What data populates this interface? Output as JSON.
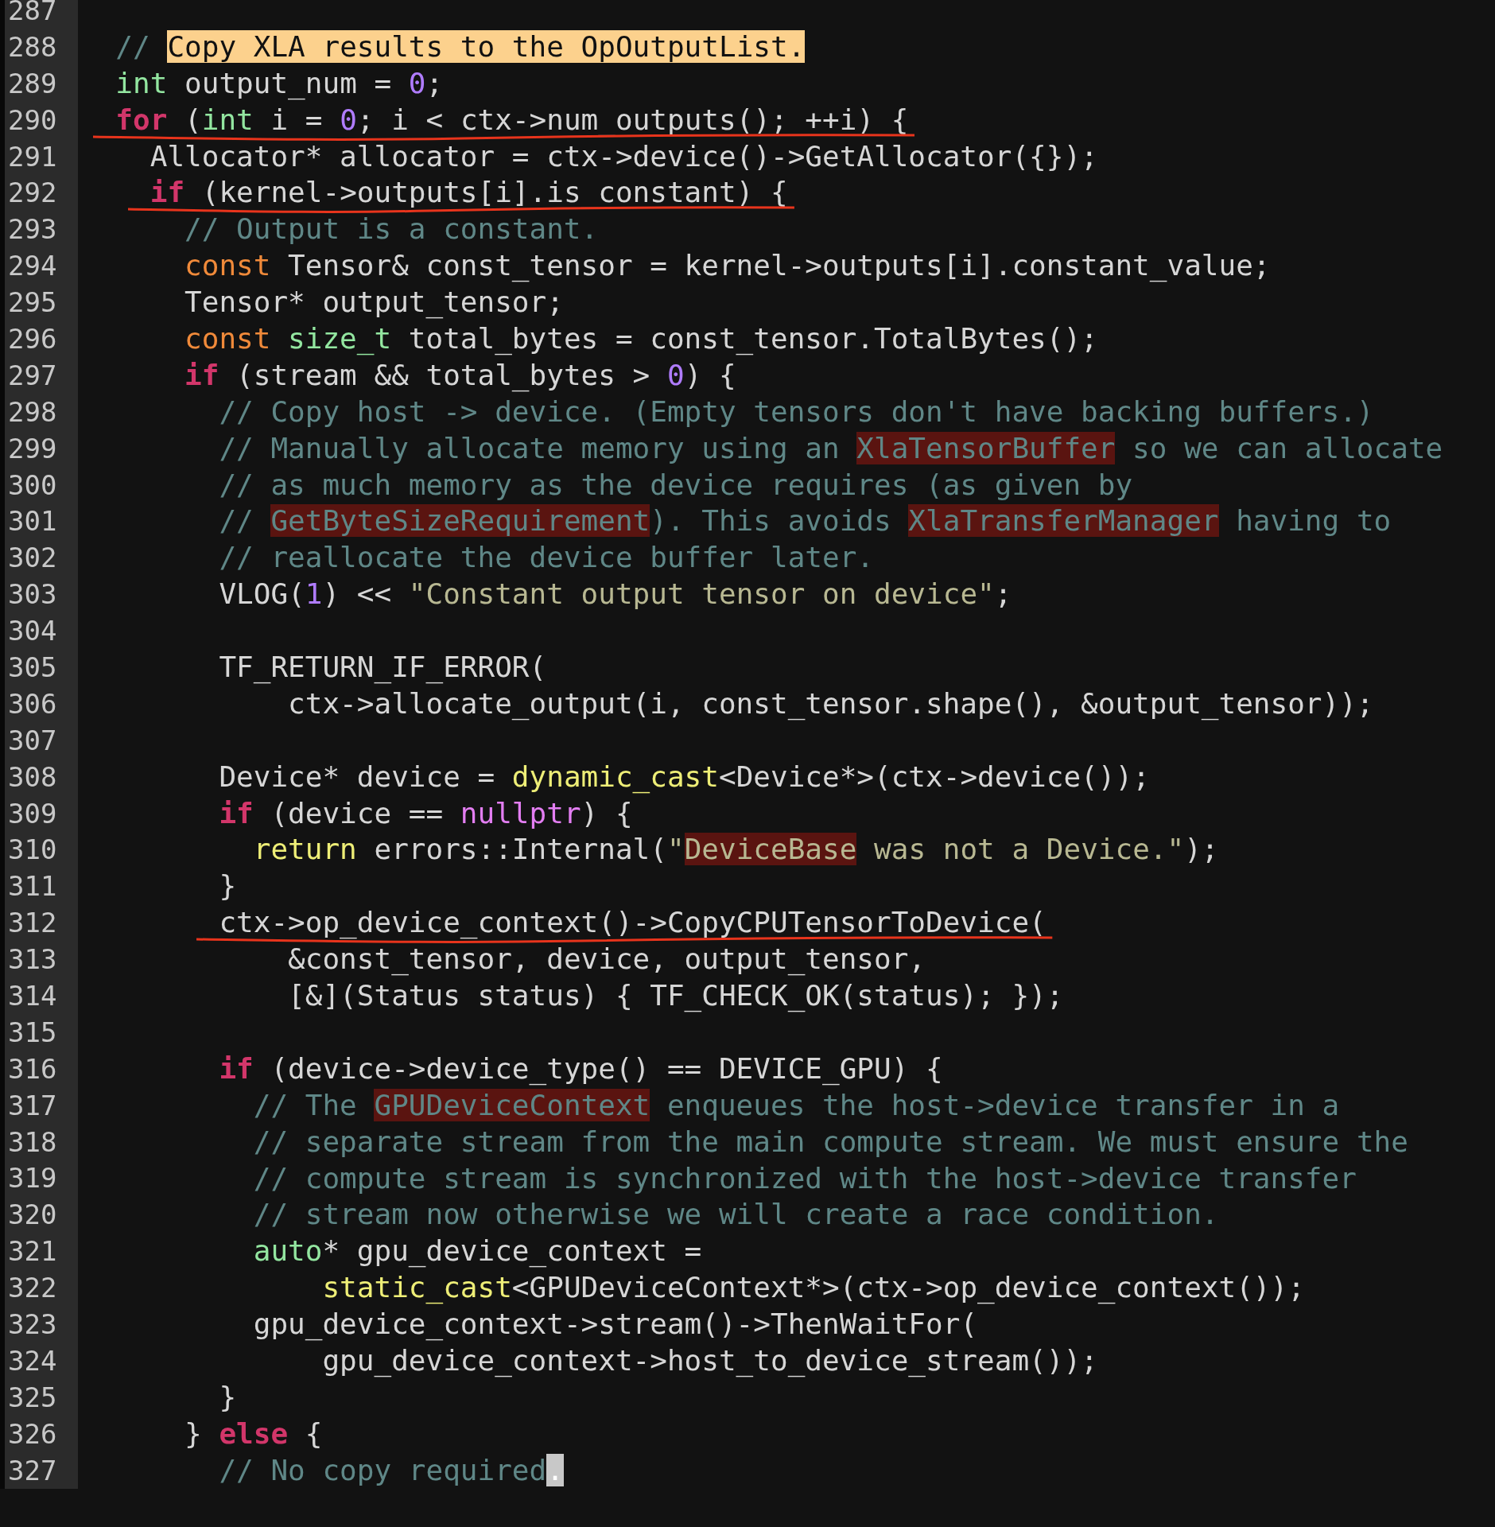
{
  "lines": [
    {
      "number": "287",
      "underlined": false
    },
    {
      "number": "288",
      "underlined": false,
      "tokens": [
        {
          "text": "  // ",
          "kind": "comment"
        },
        {
          "text": "Copy XLA results to the OpOutputList.",
          "kind": "search"
        }
      ]
    },
    {
      "number": "289",
      "underlined": false,
      "tokens": [
        {
          "text": "  int",
          "kind": "type"
        },
        {
          "text": " output_num = ",
          "kind": "plain"
        },
        {
          "text": "0",
          "kind": "number"
        },
        {
          "text": ";",
          "kind": "plain"
        }
      ]
    },
    {
      "number": "290",
      "underlined": true,
      "tokens": [
        {
          "text": "  for",
          "kind": "keyword"
        },
        {
          "text": " (",
          "kind": "plain"
        },
        {
          "text": "int",
          "kind": "type"
        },
        {
          "text": " i = ",
          "kind": "plain"
        },
        {
          "text": "0",
          "kind": "number"
        },
        {
          "text": "; i < ctx->num_outputs(); ++i) {",
          "kind": "plain"
        }
      ]
    },
    {
      "number": "291",
      "underlined": false,
      "tokens": [
        {
          "text": "    Allocator* allocator = ctx->device()->GetAllocator({});",
          "kind": "plain"
        }
      ]
    },
    {
      "number": "292",
      "underlined": true,
      "tokens": [
        {
          "text": "    if",
          "kind": "keyword"
        },
        {
          "text": " (kernel->outputs[i].is_constant) {",
          "kind": "plain"
        }
      ]
    },
    {
      "number": "293",
      "underlined": false,
      "tokens": [
        {
          "text": "      // Output is a constant.",
          "kind": "comment"
        }
      ]
    },
    {
      "number": "294",
      "underlined": false,
      "tokens": [
        {
          "text": "      const",
          "kind": "qualifier"
        },
        {
          "text": " Tensor& const_tensor = kernel->outputs[i].constant_value;",
          "kind": "plain"
        }
      ]
    },
    {
      "number": "295",
      "underlined": false,
      "tokens": [
        {
          "text": "      Tensor* output_tensor;",
          "kind": "plain"
        }
      ]
    },
    {
      "number": "296",
      "underlined": false,
      "tokens": [
        {
          "text": "      const ",
          "kind": "qualifier"
        },
        {
          "text": "size_t",
          "kind": "type"
        },
        {
          "text": " total_bytes = const_tensor.TotalBytes();",
          "kind": "plain"
        }
      ]
    },
    {
      "number": "297",
      "underlined": false,
      "tokens": [
        {
          "text": "      if",
          "kind": "keyword"
        },
        {
          "text": " (stream && total_bytes > ",
          "kind": "plain"
        },
        {
          "text": "0",
          "kind": "number"
        },
        {
          "text": ") {",
          "kind": "plain"
        }
      ]
    },
    {
      "number": "298",
      "underlined": false,
      "tokens": [
        {
          "text": "        // Copy host -> device. (Empty tensors don't have backing buffers.)",
          "kind": "comment"
        }
      ]
    },
    {
      "number": "299",
      "underlined": false,
      "tokens": [
        {
          "text": "        // Manually allocate memory using an ",
          "kind": "comment"
        },
        {
          "text": "XlaTensorBuffer",
          "kind": "flagcomment"
        },
        {
          "text": " so we can allocate",
          "kind": "comment"
        }
      ]
    },
    {
      "number": "300",
      "underlined": false,
      "tokens": [
        {
          "text": "        // as much memory as the device requires (as given by",
          "kind": "comment"
        }
      ]
    },
    {
      "number": "301",
      "underlined": false,
      "tokens": [
        {
          "text": "        // ",
          "kind": "comment"
        },
        {
          "text": "GetByteSizeRequirement",
          "kind": "flagcomment"
        },
        {
          "text": "). This avoids ",
          "kind": "comment"
        },
        {
          "text": "XlaTransferManager",
          "kind": "flagcomment"
        },
        {
          "text": " having to",
          "kind": "comment"
        }
      ]
    },
    {
      "number": "302",
      "underlined": false,
      "tokens": [
        {
          "text": "        // reallocate the device buffer later.",
          "kind": "comment"
        }
      ]
    },
    {
      "number": "303",
      "underlined": false,
      "tokens": [
        {
          "text": "        VLOG(",
          "kind": "plain"
        },
        {
          "text": "1",
          "kind": "number"
        },
        {
          "text": ") << ",
          "kind": "plain"
        },
        {
          "text": "\"Constant output tensor on device\"",
          "kind": "string"
        },
        {
          "text": ";",
          "kind": "plain"
        }
      ]
    },
    {
      "number": "304",
      "underlined": false
    },
    {
      "number": "305",
      "underlined": false,
      "tokens": [
        {
          "text": "        TF_RETURN_IF_ERROR(",
          "kind": "plain"
        }
      ]
    },
    {
      "number": "306",
      "underlined": false,
      "tokens": [
        {
          "text": "            ctx->allocate_output(i, const_tensor.shape(), &output_tensor));",
          "kind": "plain"
        }
      ]
    },
    {
      "number": "307",
      "underlined": false
    },
    {
      "number": "308",
      "underlined": false,
      "tokens": [
        {
          "text": "        Device* device = ",
          "kind": "plain"
        },
        {
          "text": "dynamic_cast",
          "kind": "builtin"
        },
        {
          "text": "<Device*>(ctx->device());",
          "kind": "plain"
        }
      ]
    },
    {
      "number": "309",
      "underlined": false,
      "tokens": [
        {
          "text": "        if",
          "kind": "keyword"
        },
        {
          "text": " (device == ",
          "kind": "plain"
        },
        {
          "text": "nullptr",
          "kind": "constant"
        },
        {
          "text": ") {",
          "kind": "plain"
        }
      ]
    },
    {
      "number": "310",
      "underlined": false,
      "tokens": [
        {
          "text": "          return",
          "kind": "builtin"
        },
        {
          "text": " errors::Internal(",
          "kind": "plain"
        },
        {
          "text": "\"",
          "kind": "string"
        },
        {
          "text": "DeviceBase",
          "kind": "flagstring"
        },
        {
          "text": " was not a Device.\"",
          "kind": "string"
        },
        {
          "text": ");",
          "kind": "plain"
        }
      ]
    },
    {
      "number": "311",
      "underlined": false,
      "tokens": [
        {
          "text": "        }",
          "kind": "plain"
        }
      ]
    },
    {
      "number": "312",
      "underlined": true,
      "tokens": [
        {
          "text": "        ctx->op_device_context()->CopyCPUTensorToDevice(",
          "kind": "plain"
        }
      ]
    },
    {
      "number": "313",
      "underlined": false,
      "tokens": [
        {
          "text": "            &const_tensor, device, output_tensor,",
          "kind": "plain"
        }
      ]
    },
    {
      "number": "314",
      "underlined": false,
      "tokens": [
        {
          "text": "            [&](Status status) { TF_CHECK_OK(status); });",
          "kind": "plain"
        }
      ]
    },
    {
      "number": "315",
      "underlined": false
    },
    {
      "number": "316",
      "underlined": false,
      "tokens": [
        {
          "text": "        if",
          "kind": "keyword"
        },
        {
          "text": " (device->device_type() == DEVICE_GPU) {",
          "kind": "plain"
        }
      ]
    },
    {
      "number": "317",
      "underlined": false,
      "tokens": [
        {
          "text": "          // The ",
          "kind": "comment"
        },
        {
          "text": "GPUDeviceContext",
          "kind": "flagcomment"
        },
        {
          "text": " enqueues the host->device transfer in a",
          "kind": "comment"
        }
      ]
    },
    {
      "number": "318",
      "underlined": false,
      "tokens": [
        {
          "text": "          // separate stream from the main compute stream. We must ensure the",
          "kind": "comment"
        }
      ]
    },
    {
      "number": "319",
      "underlined": false,
      "tokens": [
        {
          "text": "          // compute stream is synchronized with the host->device transfer",
          "kind": "comment"
        }
      ]
    },
    {
      "number": "320",
      "underlined": false,
      "tokens": [
        {
          "text": "          // stream now otherwise we will create a race condition.",
          "kind": "comment"
        }
      ]
    },
    {
      "number": "321",
      "underlined": false,
      "tokens": [
        {
          "text": "          auto",
          "kind": "type"
        },
        {
          "text": "* gpu_device_context =",
          "kind": "plain"
        }
      ]
    },
    {
      "number": "322",
      "underlined": false,
      "tokens": [
        {
          "text": "              static_cast",
          "kind": "builtin"
        },
        {
          "text": "<GPUDeviceContext*>(ctx->op_device_context());",
          "kind": "plain"
        }
      ]
    },
    {
      "number": "323",
      "underlined": false,
      "tokens": [
        {
          "text": "          gpu_device_context->stream()->ThenWaitFor(",
          "kind": "plain"
        }
      ]
    },
    {
      "number": "324",
      "underlined": false,
      "tokens": [
        {
          "text": "              gpu_device_context->host_to_device_stream());",
          "kind": "plain"
        }
      ]
    },
    {
      "number": "325",
      "underlined": false,
      "tokens": [
        {
          "text": "        }",
          "kind": "plain"
        }
      ]
    },
    {
      "number": "326",
      "underlined": false,
      "tokens": [
        {
          "text": "      } ",
          "kind": "plain"
        },
        {
          "text": "else",
          "kind": "keyword"
        },
        {
          "text": " {",
          "kind": "plain"
        }
      ]
    },
    {
      "number": "327",
      "underlined": false,
      "tokens": [
        {
          "text": "        // No copy required",
          "kind": "comment"
        },
        {
          "text": ".",
          "kind": "cursor"
        }
      ]
    }
  ]
}
